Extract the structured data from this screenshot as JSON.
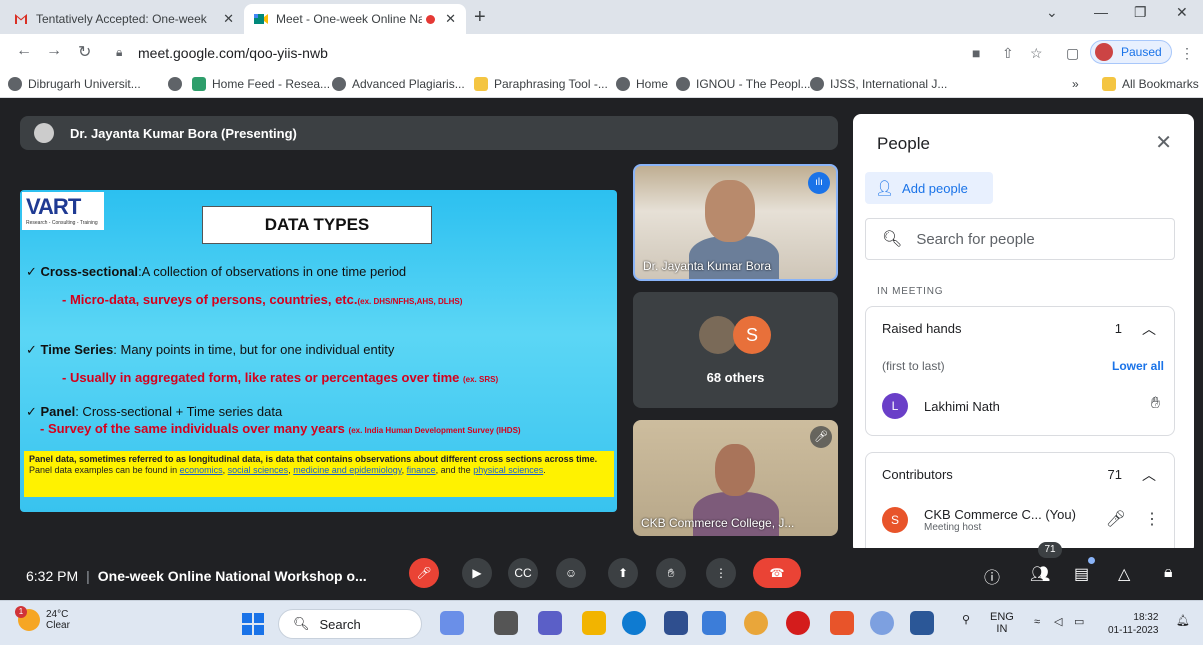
{
  "browser": {
    "tabs": [
      {
        "title": "Tentatively Accepted: One-week",
        "favicon": "gmail-icon"
      },
      {
        "title": "Meet - One-week Online Na",
        "favicon": "meet-icon",
        "recording": true
      }
    ],
    "url": "meet.google.com/qoo-yiis-nwb",
    "profile_status": "Paused",
    "bookmarks": [
      "Dibrugarh Universit...",
      "",
      "Home Feed - Resea...",
      "Advanced Plagiaris...",
      "Paraphrasing Tool -...",
      "Home",
      "IGNOU - The Peopl...",
      "IJSS, International J..."
    ],
    "all_bookmarks": "All Bookmarks",
    "more_bookmarks": "»"
  },
  "meet": {
    "presenter": "Dr. Jayanta Kumar Bora (Presenting)",
    "slide": {
      "logo": "VART",
      "logo_sub": "Research - Consulting - Training",
      "title": "DATA TYPES",
      "cross_label": "Cross-sectional",
      "cross_text": ":A collection of observations in one time period",
      "cross_sub": "- Micro-data, surveys of persons, countries, etc.",
      "cross_sub_small": "(ex. DHS/NFHS,AHS, DLHS)",
      "ts_label": "Time Series",
      "ts_text": ": Many points in time, but for one individual entity",
      "ts_sub": "- Usually in aggregated form, like rates or percentages over time",
      "ts_sub_small": "(ex. SRS)",
      "panel_label": "Panel",
      "panel_text": ": Cross-sectional + Time series data",
      "panel_sub": "- Survey of the same individuals over many years",
      "panel_sub_small": "(ex. India Human Development Survey (IHDS)",
      "note_bold": "Panel data, sometimes referred to as longitudinal data, is data that contains observations about different cross sections across time.",
      "note_text": " Panel data examples can be found in ",
      "note_links": [
        "economics",
        "social sciences",
        "medicine and epidemiology",
        "finance",
        "physical sciences"
      ],
      "note_sep1": ", ",
      "note_and": ", and the ",
      "note_end": "."
    },
    "tiles": [
      {
        "name": "Dr. Jayanta Kumar Bora"
      },
      {
        "name": "68 others",
        "avatar_letter": "S"
      },
      {
        "name": "CKB Commerce College, J..."
      }
    ]
  },
  "people_panel": {
    "title": "People",
    "add_people": "Add people",
    "search_placeholder": "Search for people",
    "in_meeting": "IN MEETING",
    "raised_hands": {
      "label": "Raised hands",
      "count": "1",
      "order": "(first to last)",
      "lower_all": "Lower all",
      "person": {
        "name": "Lakhimi Nath",
        "letter": "L",
        "color": "#6a3fc8"
      }
    },
    "contributors": {
      "label": "Contributors",
      "count": "71",
      "person": {
        "name": "CKB Commerce C... (You)",
        "meta": "Meeting host",
        "letter": "S",
        "color": "#e8542a"
      }
    }
  },
  "controls": {
    "time": "6:32 PM",
    "meeting_name": "One-week Online National Workshop o...",
    "people_count": "71",
    "cc_label": "CC"
  },
  "taskbar": {
    "temperature": "24°C",
    "weather": "Clear",
    "weather_badge": "1",
    "search": "Search",
    "lang": "ENG",
    "region": "IN",
    "time": "18:32",
    "date": "01-11-2023"
  },
  "colors": {
    "accent": "#1a73e8",
    "end_call": "#ea4335",
    "slide_red": "#d6001c",
    "note_yellow": "#fff200"
  }
}
